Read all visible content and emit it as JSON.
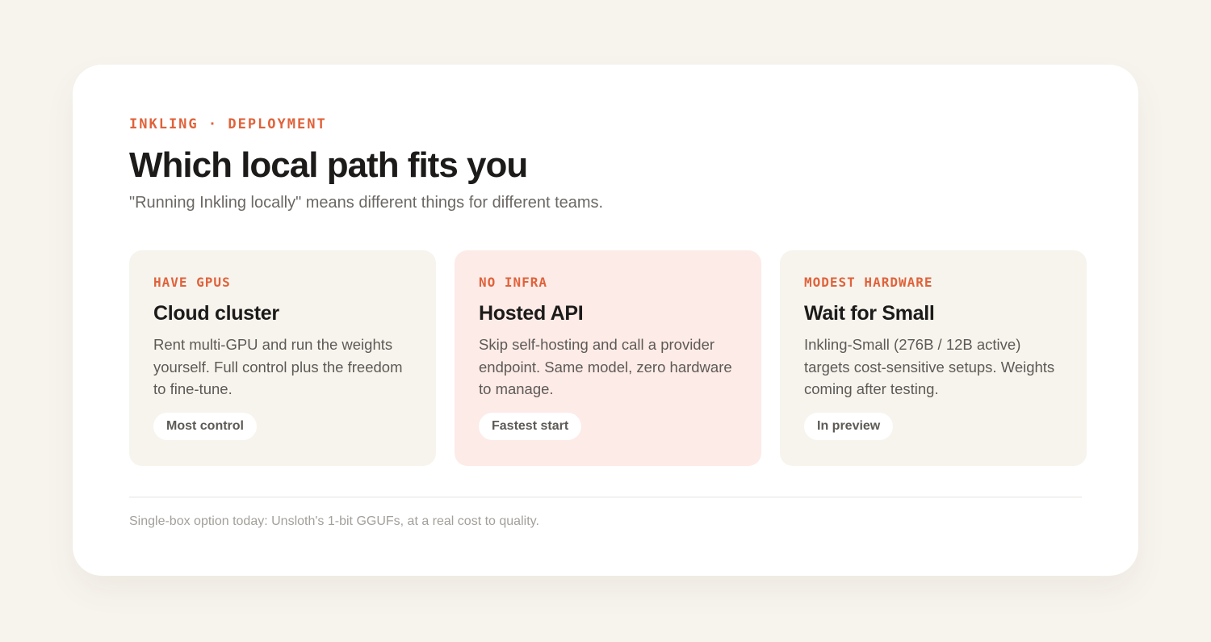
{
  "header": {
    "eyebrow": "INKLING · DEPLOYMENT",
    "title": "Which local path fits you",
    "subtitle": "\"Running Inkling locally\" means different things for different teams."
  },
  "options": [
    {
      "tag": "HAVE GPUS",
      "title": "Cloud cluster",
      "description": "Rent multi-GPU and run the weights yourself. Full control plus the freedom to fine-tune.",
      "pill": "Most control"
    },
    {
      "tag": "NO INFRA",
      "title": "Hosted API",
      "description": "Skip self-hosting and call a provider endpoint. Same model, zero hardware to manage.",
      "pill": "Fastest start"
    },
    {
      "tag": "MODEST HARDWARE",
      "title": "Wait for Small",
      "description": "Inkling-Small (276B / 12B active) targets cost-sensitive setups. Weights coming after testing.",
      "pill": "In preview"
    }
  ],
  "footnote": "Single-box option today: Unsloth's 1-bit GGUFs, at a real cost to quality.",
  "colors": {
    "accent": "#e0623a",
    "highlight_card": "#fdebe7",
    "card": "#f7f4ee"
  }
}
